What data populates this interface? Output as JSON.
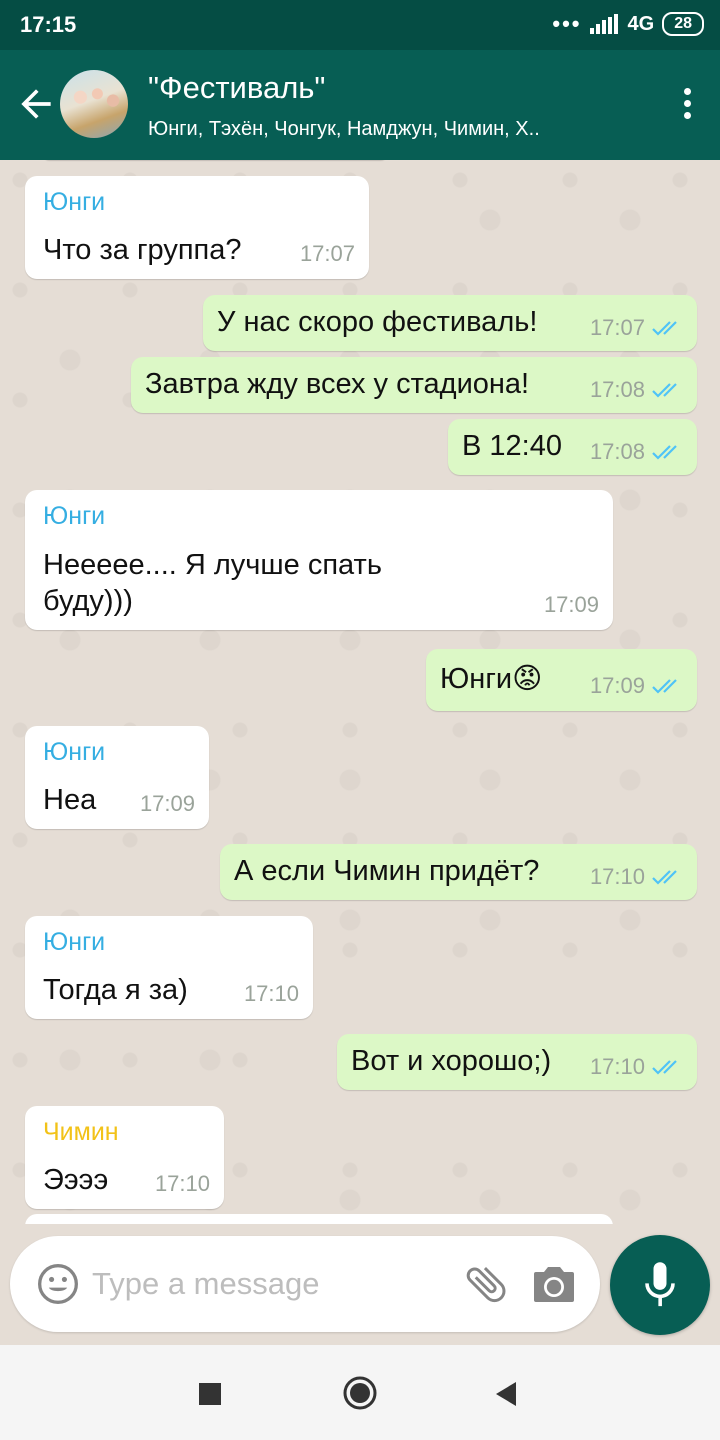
{
  "status_bar": {
    "time": "17:15",
    "network": "4G",
    "battery": "28"
  },
  "header": {
    "title": "\"Фестиваль\"",
    "subtitle": "Юнги, Тэхён, Чонгук, Намджун, Чимин, Х.."
  },
  "messages": [
    {
      "sender": "Юнги",
      "text": "Что за группа?",
      "time": "17:07"
    },
    {
      "text": "У нас скоро фестиваль!",
      "time": "17:07"
    },
    {
      "text": "Завтра жду всех у стадиона!",
      "time": "17:08"
    },
    {
      "text": "В 12:40",
      "time": "17:08"
    },
    {
      "sender": "Юнги",
      "text_line1": "Нееееe.... Я лучше спать",
      "text_line2": "буду)))",
      "time": "17:09"
    },
    {
      "text": "Юнги",
      "emoji": "😡",
      "time": "17:09"
    },
    {
      "sender": "Юнги",
      "text": "Неа",
      "time": "17:09"
    },
    {
      "text": "А если Чимин придёт?",
      "time": "17:10"
    },
    {
      "sender": "Юнги",
      "text": "Тогда я за)",
      "time": "17:10"
    },
    {
      "text": "Вот и хорошо;)",
      "time": "17:10"
    },
    {
      "sender": "Чимин",
      "text": "Ээээ",
      "time": "17:10"
    }
  ],
  "input": {
    "placeholder": "Type a message"
  },
  "icons": {
    "back": "arrow-left-icon",
    "menu": "more-vert-icon",
    "emoji": "emoji-icon",
    "attach": "paperclip-icon",
    "camera": "camera-icon",
    "mic": "mic-icon",
    "read": "double-check-icon"
  },
  "colors": {
    "header": "#075e54",
    "status_bar": "#054d44",
    "outgoing_bubble": "#dcf8c6",
    "incoming_bubble": "#ffffff",
    "sender_yunghi": "#35aee2",
    "sender_chimin": "#f2c218",
    "read_tick": "#4fc3f7"
  }
}
